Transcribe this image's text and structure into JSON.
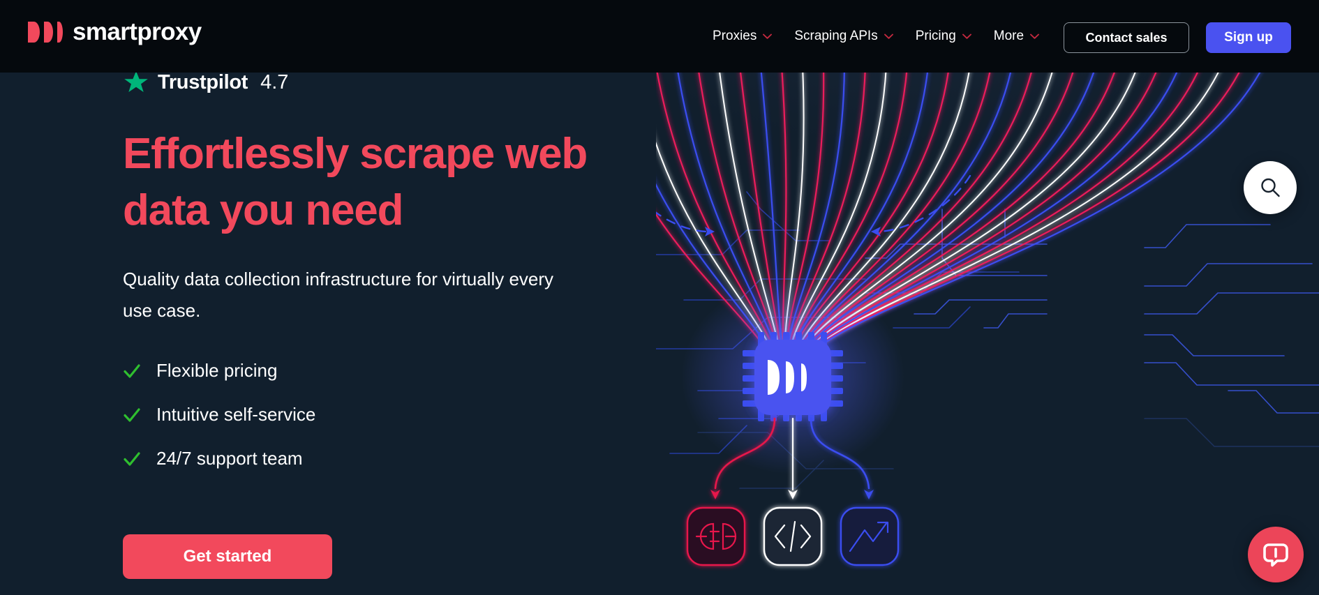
{
  "brand": {
    "name": "smartproxy",
    "logo_icon": "smartproxy-logo-mark",
    "accent_pink": "#f2495c",
    "accent_blue": "#4a52f0",
    "accent_green": "#2fbf2f",
    "bg_dark": "#111f2d",
    "header_bg": "#05090d"
  },
  "header": {
    "nav": [
      {
        "label": "Proxies",
        "icon": "chevron-down-icon"
      },
      {
        "label": "Scraping APIs",
        "icon": "chevron-down-icon"
      },
      {
        "label": "Pricing",
        "icon": "chevron-down-icon"
      },
      {
        "label": "More",
        "icon": "chevron-down-icon"
      }
    ],
    "contact_label": "Contact sales",
    "signup_label": "Sign up"
  },
  "hero": {
    "trustpilot": {
      "icon": "trustpilot-star-icon",
      "name": "Trustpilot",
      "score": "4.7"
    },
    "title": "Effortlessly scrape web data you need",
    "subtitle": "Quality data collection infrastructure for virtually every use case.",
    "features": [
      {
        "icon": "check-icon",
        "label": "Flexible pricing"
      },
      {
        "icon": "check-icon",
        "label": "Intuitive self-service"
      },
      {
        "icon": "check-icon",
        "label": "24/7 support team"
      }
    ],
    "cta_label": "Get started"
  },
  "illustration": {
    "name": "data-scraping-chip-illustration",
    "chip_icon": "smartproxy-chip-icon",
    "nodes": [
      {
        "icon": "plug-connector-icon",
        "color": "#e8174b"
      },
      {
        "icon": "code-brackets-icon",
        "color": "#ffffff"
      },
      {
        "icon": "trend-up-chart-icon",
        "color": "#3a4df0"
      }
    ],
    "stream_colors": [
      "#ec1a5c",
      "#3a4df0",
      "#ffffff"
    ]
  },
  "widgets": {
    "search_icon": "search-icon",
    "chat_icon": "chat-bubble-icon"
  }
}
